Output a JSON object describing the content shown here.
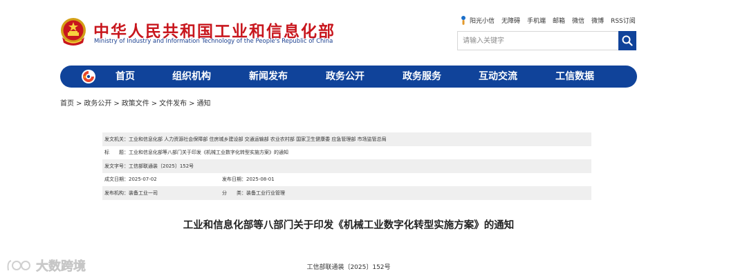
{
  "header": {
    "site_title": "中华人民共和国工业和信息化部",
    "site_subtitle": "Ministry of Industry and Information Technology of the People's Republic of China",
    "top_links": [
      "阳光小信",
      "无障碍",
      "手机端",
      "邮箱",
      "微信",
      "微博",
      "RSS订阅"
    ],
    "search_placeholder": "请输入关键字"
  },
  "nav": {
    "items": [
      "首页",
      "组织机构",
      "新闻发布",
      "政务公开",
      "政务服务",
      "互动交流",
      "工信数据"
    ]
  },
  "breadcrumb": [
    "首页",
    "政务公开",
    "政策文件",
    "文件发布",
    "通知"
  ],
  "meta": {
    "issuer_label": "发文机关：",
    "issuer_value": "工业和信息化部 人力资源社会保障部 住房城乡建设部 交通运输部 农业农村部 国家卫生健康委 应急管理部 市场监管总局",
    "title_label": "标　　题：",
    "title_value": "工业和信息化部等八部门关于印发《机械工业数字化转型实施方案》的通知",
    "docno_label": "发文字号：",
    "docno_value": "工信部联通装〔2025〕152号",
    "created_label": "成文日期：",
    "created_value": "2025-07-02",
    "published_label": "发布日期：",
    "published_value": "2025-08-01",
    "org_label": "发布机构：",
    "org_value": "装备工业一司",
    "category_label": "分　　类：",
    "category_value": "装备工业行业管理"
  },
  "document": {
    "title": "工业和信息化部等八部门关于印发《机械工业数字化转型实施方案》的通知",
    "number": "工信部联通装〔2025〕152号"
  },
  "watermark": {
    "text": "大数跨境"
  },
  "colors": {
    "brand_red": "#c8161d",
    "brand_blue": "#10439a",
    "shade": "#efefef"
  }
}
